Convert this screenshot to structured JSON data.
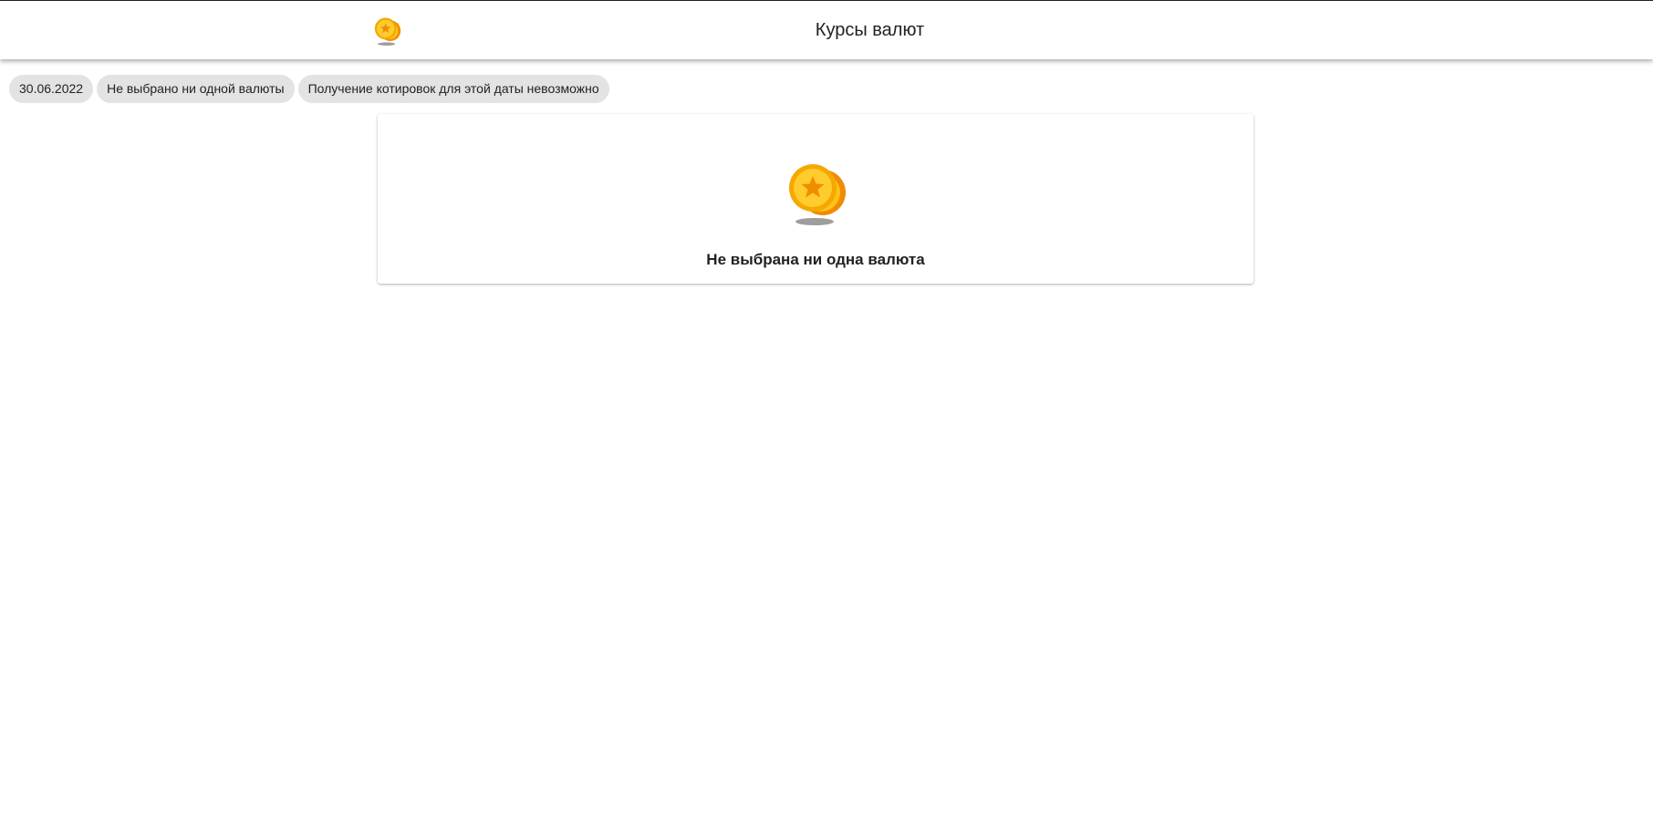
{
  "header": {
    "title": "Курсы валют",
    "logo_icon": "coins-icon"
  },
  "filters": {
    "date": "30.06.2022",
    "currency": "Не выбрано ни одной валюты",
    "status": "Получение котировок для этой даты невозможно"
  },
  "empty_state": {
    "icon": "coins-icon",
    "message": "Не выбрана ни одна валюта"
  },
  "colors": {
    "coin_gold": "#f5b400",
    "coin_orange": "#f08c00",
    "chip_bg": "#e3e3e3"
  }
}
